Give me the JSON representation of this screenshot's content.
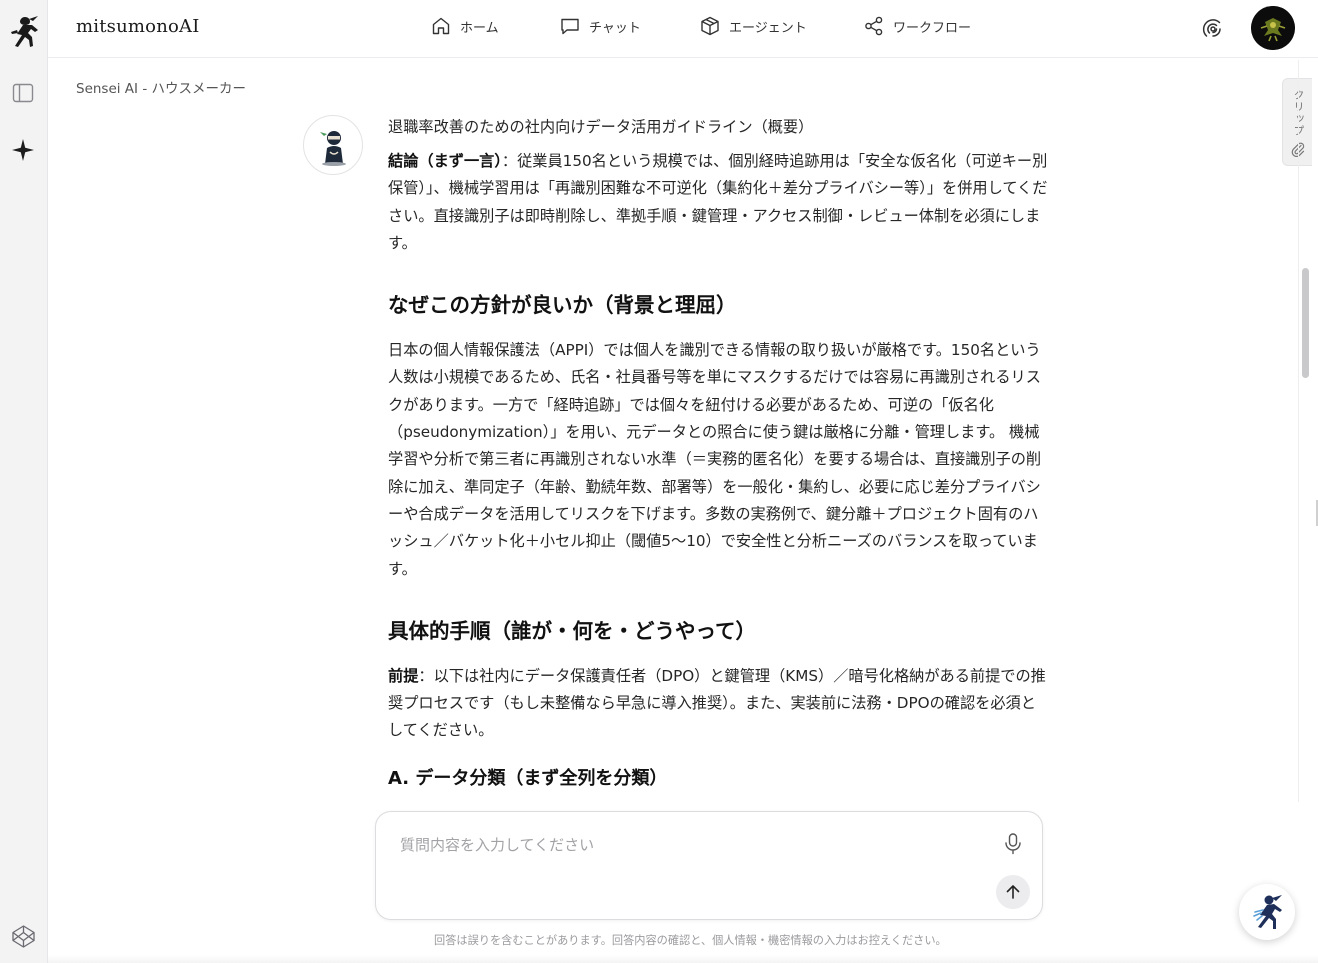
{
  "app": {
    "brand": "mitsumonoAI"
  },
  "nav": {
    "home": "ホーム",
    "chat": "チャット",
    "agent": "エージェント",
    "workflow": "ワークフロー"
  },
  "breadcrumb": "Sensei AI - ハウスメーカー",
  "clip_tab": "クリップ",
  "message": {
    "title": "退職率改善のための社内向けデータ活用ガイドライン（概要）",
    "conclusion_label": "結論（まず一言）",
    "conclusion_text": "：従業員150名という規模では、個別経時追跡用は「安全な仮名化（可逆キー別保管）」、機械学習用は「再識別困難な不可逆化（集約化＋差分プライバシー等）」を併用してください。直接識別子は即時削除し、準拠手順・鍵管理・アクセス制御・レビュー体制を必須にします。",
    "h_why": "なぜこの方針が良いか（背景と理屈）",
    "why_text": "日本の個人情報保護法（APPI）では個人を識別できる情報の取り扱いが厳格です。150名という人数は小規模であるため、氏名・社員番号等を単にマスクするだけでは容易に再識別されるリスクがあります。一方で「経時追跡」では個々を紐付ける必要があるため、可逆の「仮名化（pseudonymization）」を用い、元データとの照合に使う鍵は厳格に分離・管理します。 機械学習や分析で第三者に再識別されない水準（＝実務的匿名化）を要する場合は、直接識別子の削除に加え、準同定子（年齢、勤続年数、部署等）を一般化・集約し、必要に応じ差分プライバシーや合成データを活用してリスクを下げます。多数の実務例で、鍵分離＋プロジェクト固有のハッシュ／バケット化＋小セル抑止（閾値5〜10）で安全性と分析ニーズのバランスを取っています。",
    "h_steps": "具体的手順（誰が・何を・どうやって）",
    "premise_label": "前提",
    "premise_text": "：以下は社内にデータ保護責任者（DPO）と鍵管理（KMS）／暗号化格納がある前提での推奨プロセスです（もし未整備なら早急に導入推奨）。また、実装前に法務・DPOの確認を必須としてください。",
    "h_a": "A. データ分類（まず全列を分類）"
  },
  "composer": {
    "placeholder": "質問内容を入力してください"
  },
  "disclaimer": "回答は誤りを含むことがあります。回答内容の確認と、個人情報・機密情報の入力はお控えください。"
}
